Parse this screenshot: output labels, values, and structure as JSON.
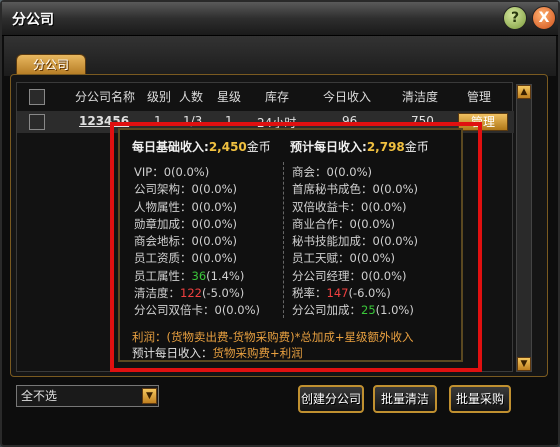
{
  "window": {
    "title": "分公司",
    "help_icon": "?",
    "close_icon": "X"
  },
  "tab": {
    "label": "分公司"
  },
  "table": {
    "headers": [
      "分公司名称",
      "级别",
      "人数",
      "星级",
      "库存",
      "今日收入",
      "清洁度",
      "管理"
    ],
    "rows": [
      {
        "name": "123456",
        "level": "1",
        "people": "1/3",
        "stars": "1",
        "stock": "24小时",
        "income": "96",
        "clean": "750",
        "manage": "管理"
      }
    ]
  },
  "tooltip": {
    "base_income_label": "每日基础收入:",
    "base_income_value": "2,450",
    "base_income_unit": "金币",
    "pred_income_label": "预计每日收入:",
    "pred_income_value": "2,798",
    "pred_income_unit": "金币",
    "left": [
      {
        "label": "VIP：",
        "value": "0(0.0%)",
        "color": "normal"
      },
      {
        "label": "公司架构：",
        "value": "0(0.0%)",
        "color": "normal"
      },
      {
        "label": "人物属性：",
        "value": "0(0.0%)",
        "color": "normal"
      },
      {
        "label": "勋章加成：",
        "value": "0(0.0%)",
        "color": "normal"
      },
      {
        "label": "商会地标：",
        "value": "0(0.0%)",
        "color": "normal"
      },
      {
        "label": "员工资质：",
        "value": "0(0.0%)",
        "color": "normal"
      },
      {
        "label": "员工属性：",
        "value": "36",
        "extra": "(1.4%)",
        "color": "green"
      },
      {
        "label": "清洁度：",
        "value": "122",
        "extra": "(-5.0%)",
        "color": "red"
      },
      {
        "label": "分公司双倍卡：",
        "value": "0(0.0%)",
        "color": "normal"
      }
    ],
    "right": [
      {
        "label": "商会：",
        "value": "0(0.0%)",
        "color": "normal"
      },
      {
        "label": "首席秘书成色：",
        "value": "0(0.0%)",
        "color": "normal"
      },
      {
        "label": "双倍收益卡：",
        "value": "0(0.0%)",
        "color": "normal"
      },
      {
        "label": "商业合作：",
        "value": "0(0.0%)",
        "color": "normal"
      },
      {
        "label": "秘书技能加成：",
        "value": "0(0.0%)",
        "color": "normal"
      },
      {
        "label": "员工天赋：",
        "value": "0(0.0%)",
        "color": "normal"
      },
      {
        "label": "分公司经理：",
        "value": "0(0.0%)",
        "color": "normal"
      },
      {
        "label": "税率：",
        "value": "147",
        "extra": "(-6.0%)",
        "color": "red"
      },
      {
        "label": "分公司加成：",
        "value": "25",
        "extra": "(1.0%)",
        "color": "green"
      }
    ],
    "formula_profit": "利润：(货物卖出费-货物采购费)*总加成+星级额外收入",
    "formula_pred_label": "预计每日收入：",
    "formula_pred_value": "货物采购费+利润"
  },
  "footer": {
    "select_value": "全不选",
    "create_button": "创建分公司",
    "batch_clean_button": "批量清洁",
    "batch_buy_button": "批量采购"
  },
  "colors": {
    "accent": "#c09030",
    "highlight_frame": "#e01010",
    "green": "#3ac83a",
    "red": "#f04040"
  }
}
